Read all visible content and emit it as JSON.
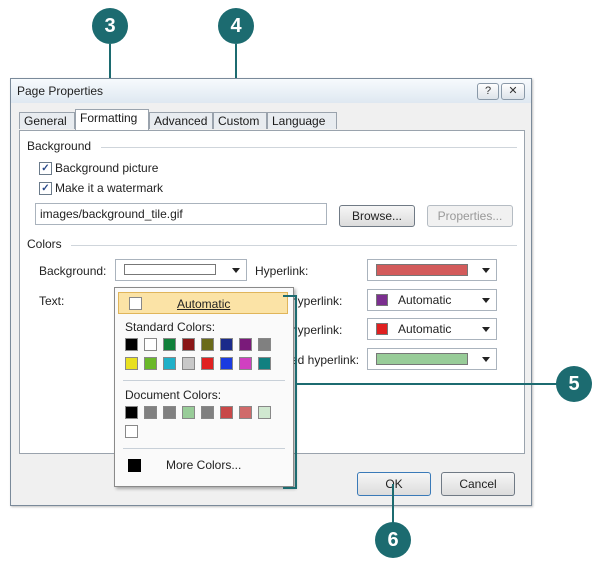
{
  "callouts": {
    "c3": "3",
    "c4": "4",
    "c5": "5",
    "c6": "6"
  },
  "dialog": {
    "title": "Page Properties",
    "help_label": "?",
    "close_label": "✕",
    "tabs": [
      "General",
      "Formatting",
      "Advanced",
      "Custom",
      "Language"
    ],
    "active_tab": "Formatting",
    "background_group": "Background",
    "bg_picture_label": "Background picture",
    "bg_picture_checked": true,
    "watermark_label": "Make it a watermark",
    "watermark_checked": true,
    "image_path": "images/background_tile.gif",
    "browse_label": "Browse...",
    "properties_label": "Properties...",
    "colors_group": "Colors",
    "background_label": "Background:",
    "text_label": "Text:",
    "hyperlink_label": "Hyperlink:",
    "visited_hyperlink_label": "hyperlink:",
    "active_hyperlink_label": "hyperlink:",
    "hovered_hyperlink_label": "ed hyperlink:",
    "hyperlink_color": "#d35b5b",
    "visited_color": "#7b2f8f",
    "visited_value": "Automatic",
    "active_color": "#e02020",
    "active_value": "Automatic",
    "hovered_color": "#98cc98",
    "ok_label": "OK",
    "cancel_label": "Cancel"
  },
  "color_popup": {
    "automatic_label": "Automatic",
    "standard_label": "Standard Colors:",
    "document_label": "Document Colors:",
    "more_label": "More Colors...",
    "standard_colors": [
      "#000000",
      "#ffffff",
      "#10803a",
      "#8a1616",
      "#6a6a1a",
      "#1a2a8a",
      "#7a1a7a",
      "#808080",
      "#e8e020",
      "#6ab82a",
      "#20b0c8",
      "#c8c8c8",
      "#e02020",
      "#1a3ae0",
      "#d040c0",
      "#108080"
    ],
    "document_colors": [
      "#000000",
      "#808080",
      "#808080",
      "#98cc98",
      "#808080",
      "#c84848",
      "#d06a6a",
      "#d0e8d0",
      "#ffffff"
    ]
  }
}
